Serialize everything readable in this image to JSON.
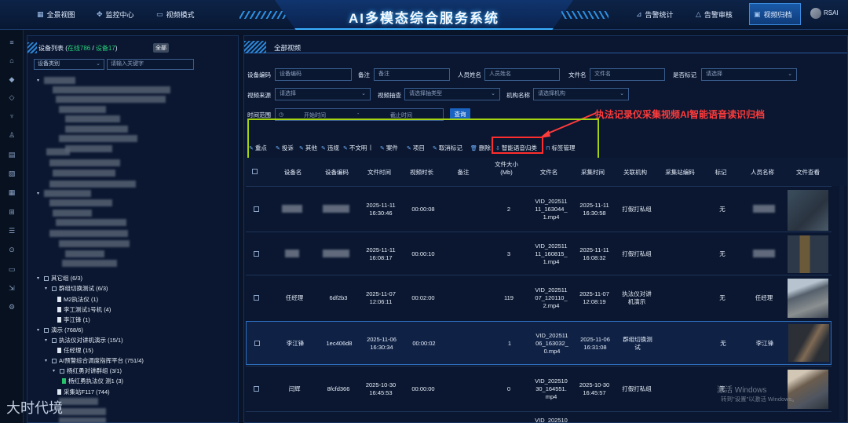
{
  "app": {
    "title": "AI多模态综合服务系统",
    "user": "RSAI"
  },
  "nav_left": [
    {
      "label": "全景视图",
      "icon": "grid-icon"
    },
    {
      "label": "监控中心",
      "icon": "monitor-icon"
    },
    {
      "label": "视频模式",
      "icon": "video-icon"
    }
  ],
  "nav_right": [
    {
      "label": "告警统计",
      "icon": "chart-icon"
    },
    {
      "label": "告警审核",
      "icon": "warning-icon"
    },
    {
      "label": "视频归档",
      "icon": "archive-icon"
    }
  ],
  "tree": {
    "title_prefix": "设备列表 (",
    "title_online": "在线786",
    "title_sep": " / ",
    "title_device": "设备17",
    "title_suffix": ")",
    "all_badge": "全部",
    "filter_label": "设备类别",
    "search_placeholder": "请输入关键字",
    "nodes": [
      "其它组 (6/3)",
      "群组切换测试 (6/3)",
      "M2执法仪 (1)",
      "李工测试1号机 (4)",
      "李江锋 (1)",
      "演示 (768/6)",
      "执法仪对讲机演示 (15/1)",
      "任经理 (15)",
      "AI预警综合调度指挥平台 (751/4)",
      "杨红勇对讲群组 (3/1)",
      "杨红勇执法仪 测1 (3)",
      "采集站F117 (744)"
    ]
  },
  "main": {
    "title": "全部视频",
    "filters": {
      "device_code_label": "设备编码",
      "device_code_placeholder": "设备编码",
      "remark_label": "备注",
      "remark_placeholder": "备注",
      "person_label": "人员姓名",
      "person_placeholder": "人员姓名",
      "file_label": "文件名",
      "file_placeholder": "文件名",
      "mark_label": "是否标记",
      "mark_placeholder": "请选择",
      "source_label": "视频来源",
      "source_placeholder": "请选择",
      "type_label": "视频抽查",
      "type_placeholder": "请选择抽类型",
      "org_label": "机构名称",
      "org_placeholder": "请选择机构",
      "time_label": "时间范围",
      "start_placeholder": "开始时间",
      "range_sep": "-",
      "end_placeholder": "截止时间",
      "query_button": "查询"
    },
    "annotation": "执法记录仪采集视频AI智能语音读识归档",
    "actions": [
      "重点",
      "投诉",
      "其他",
      "违规",
      "不文明",
      "|",
      "案件",
      "项目",
      "取消标记",
      "删除",
      "智能语音归类",
      "标签管理"
    ],
    "columns": [
      "设备名",
      "设备编码",
      "文件时间",
      "视频时长",
      "备注",
      "文件大小\n(Mb)",
      "文件名",
      "采集时间",
      "关联机构",
      "采集站编码",
      "标记",
      "人员名称",
      "文件查看"
    ],
    "rows": [
      {
        "name": "",
        "code": "",
        "time": "2025-11-11\n16:30:46",
        "duration": "00:00:08",
        "remark": "",
        "size": "2",
        "file": "VID_202511\n11_163044_\n1.mp4",
        "collect": "2025-11-11\n16:30:58",
        "org": "打假打私组",
        "station": "",
        "mark": "无",
        "person": ""
      },
      {
        "name": "",
        "code": "",
        "time": "2025-11-11\n16:08:17",
        "duration": "00:00:10",
        "remark": "",
        "size": "3",
        "file": "VID_202511\n11_160815_\n1.mp4",
        "collect": "2025-11-11\n16:08:32",
        "org": "打假打私组",
        "station": "",
        "mark": "无",
        "person": ""
      },
      {
        "name": "任经理",
        "code": "6df2b3",
        "time": "2025-11-07\n12:06:11",
        "duration": "00:02:00",
        "remark": "",
        "size": "119",
        "file": "VID_202511\n07_120110_\n2.mp4",
        "collect": "2025-11-07\n12:08:19",
        "org": "执法仪对讲\n机演示",
        "station": "",
        "mark": "无",
        "person": "任经理"
      },
      {
        "name": "李江锋",
        "code": "1ec406d8",
        "time": "2025-11-06\n16:30:34",
        "duration": "00:00:02",
        "remark": "",
        "size": "1",
        "file": "VID_202511\n06_163032_\n0.mp4",
        "collect": "2025-11-06\n16:31:08",
        "org": "群组切换测\n试",
        "station": "",
        "mark": "无",
        "person": "李江锋"
      },
      {
        "name": "闫辉",
        "code": "8fcfd366",
        "time": "2025-10-30\n16:45:53",
        "duration": "00:00:00",
        "remark": "",
        "size": "0",
        "file": "VID_202510\n30_164551.\nmp4",
        "collect": "2025-10-30\n16:45:57",
        "org": "打假打私组",
        "station": "",
        "mark": "无",
        "person": ""
      }
    ],
    "partial_file": "VID_202510"
  },
  "watermark": {
    "line1": "激活 Windows",
    "line2": "转到\"设置\"以激活 Windows。"
  },
  "brand": "大时代境"
}
